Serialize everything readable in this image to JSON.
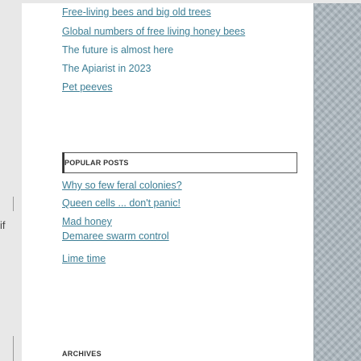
{
  "left_fragment": "if",
  "top_links": [
    {
      "label": "Free-living bees and big old trees"
    },
    {
      "label": "Global numbers of free living honey bees"
    },
    {
      "label": "The future is almost here"
    },
    {
      "label": "The Apiarist in 2023"
    },
    {
      "label": "Pet peeves"
    }
  ],
  "popular_posts": {
    "heading": "POPULAR POSTS",
    "items": [
      {
        "label": "Why so few feral colonies?"
      },
      {
        "label": "Queen cells ... don't panic!"
      },
      {
        "label": "Mad honey"
      },
      {
        "label": "Demaree swarm control"
      },
      {
        "label": "Lime time"
      }
    ]
  },
  "archives": {
    "heading": "ARCHIVES"
  }
}
